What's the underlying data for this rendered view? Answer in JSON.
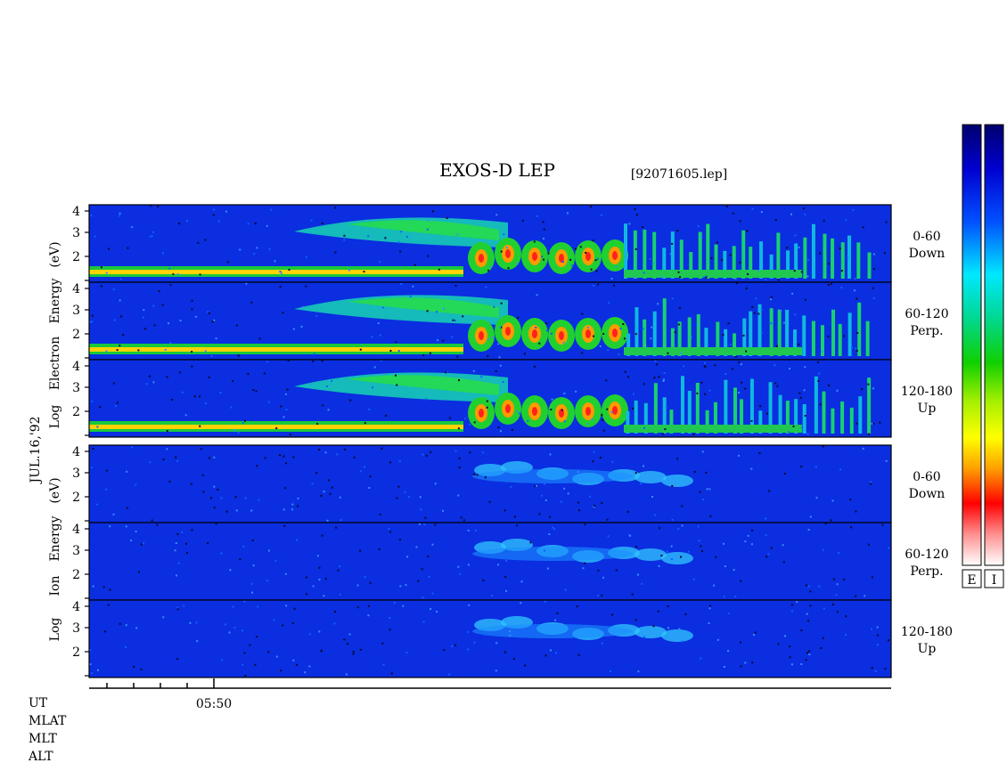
{
  "chart_data": {
    "type": "heatmap",
    "title": "EXOS-D LEP",
    "file_label": "[92071605.lep]",
    "date_label": "JUL.16,'92",
    "x_axis": {
      "tick_label": "05:50",
      "row_labels": [
        "UT",
        "MLAT",
        "MLT",
        "ALT"
      ]
    },
    "colorbars": [
      {
        "label": "E",
        "colors_top_to_bottom": [
          "#00007a",
          "#0000ff",
          "#0080ff",
          "#00ffff",
          "#00e060",
          "#40ff00",
          "#c0ff00",
          "#ffff00",
          "#ffa000",
          "#ff0000",
          "#ffffff"
        ]
      },
      {
        "label": "I",
        "colors_top_to_bottom": [
          "#00007a",
          "#0000ff",
          "#0080ff",
          "#00ffff",
          "#00e060",
          "#40ff00",
          "#c0ff00",
          "#ffff00",
          "#ffa000",
          "#ff0000",
          "#ffffff"
        ]
      }
    ],
    "groups": [
      {
        "species": "Electron",
        "ylabel_words": [
          "Log",
          "Electron",
          "Energy"
        ],
        "ylabel_unit": "(eV)",
        "yticks": [
          "4",
          "3",
          "2"
        ],
        "panels": [
          {
            "angle": "0-60",
            "direction": "Down"
          },
          {
            "angle": "60-120",
            "direction": "Perp."
          },
          {
            "angle": "120-180",
            "direction": "Up"
          }
        ]
      },
      {
        "species": "Ion",
        "ylabel_words": [
          "Log",
          "Ion",
          "Energy"
        ],
        "ylabel_unit": "(eV)",
        "yticks": [
          "4",
          "3",
          "2"
        ],
        "panels": [
          {
            "angle": "0-60",
            "direction": "Down"
          },
          {
            "angle": "60-120",
            "direction": "Perp."
          },
          {
            "angle": "120-180",
            "direction": "Up"
          }
        ]
      }
    ]
  }
}
